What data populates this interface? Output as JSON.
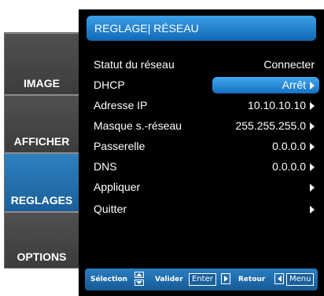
{
  "tabs": [
    {
      "label": "IMAGE",
      "active": false
    },
    {
      "label": "AFFICHER",
      "active": false
    },
    {
      "label": "REGLAGES",
      "active": true
    },
    {
      "label": "OPTIONS",
      "active": false
    }
  ],
  "menu": {
    "title": "REGLAGE| RÉSEAU",
    "rows": [
      {
        "label": "Statut du réseau",
        "value": "Connecter"
      },
      {
        "label": "DHCP",
        "value": "Arrêt"
      },
      {
        "label": "Adresse IP",
        "value": "10.10.10.10"
      },
      {
        "label": "Masque s.-réseau",
        "value": "255.255.255.0"
      },
      {
        "label": "Passerelle",
        "value": "0.0.0.0"
      },
      {
        "label": "DNS",
        "value": "0.0.0.0"
      },
      {
        "label": "Appliquer",
        "value": ""
      },
      {
        "label": "Quitter",
        "value": ""
      }
    ]
  },
  "help": {
    "select_label": "Sélection",
    "validate_label": "Valider",
    "enter_key": "Enter",
    "back_label": "Retour",
    "menu_key": "Menu"
  },
  "colors": {
    "accent": "#1a73c4",
    "panel_bg": "#000000",
    "tab_bg": "#444444",
    "sidebar_bg": "#8c8c8c"
  },
  "icons": [
    "up-down-arrows-icon",
    "right-arrow-icon",
    "left-arrow-icon",
    "chevron-right-icon"
  ]
}
